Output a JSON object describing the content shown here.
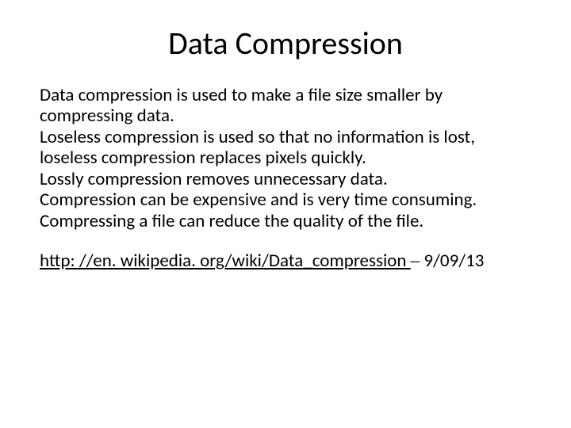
{
  "title": "Data Compression",
  "body": {
    "p1": "Data compression is used to make a file size smaller by compressing data.",
    "p2": "Loseless compression is used so that no information is lost, loseless compression replaces pixels quickly.",
    "p3": "Lossly compression removes unnecessary data.",
    "p4": "Compression can be expensive and is very time consuming.",
    "p5": "Compressing a file can reduce the quality of the file."
  },
  "source": {
    "prefix": " ",
    "link_text": "http: //en. wikipedia. org/wiki/Data_compression ",
    "dash": "–",
    "date": " 9/09/13"
  }
}
